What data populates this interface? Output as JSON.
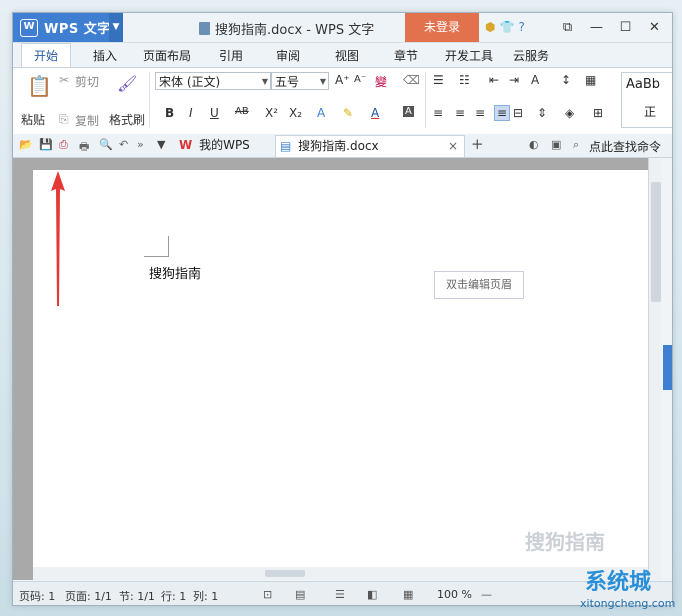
{
  "app": {
    "name": "WPS 文字",
    "logo": "W",
    "doc_title": "搜狗指南.docx - WPS 文字",
    "login": "未登录"
  },
  "menu": {
    "tabs": [
      "开始",
      "插入",
      "页面布局",
      "引用",
      "审阅",
      "视图",
      "章节",
      "开发工具",
      "云服务"
    ]
  },
  "ribbon": {
    "paste": "粘贴",
    "cut": "剪切",
    "copy": "复制",
    "format_painter": "格式刷",
    "font": "宋体 (正文)",
    "size": "五号",
    "style_preview": "AaBb",
    "style_name": "正"
  },
  "quickbar": {
    "tabs": [
      "我的WPS",
      "搜狗指南.docx"
    ],
    "search": "点此查找命令"
  },
  "document": {
    "text": "搜狗指南",
    "header_hint": "双击编辑页眉"
  },
  "status": {
    "page_code": "页码: 1",
    "page": "页面: 1/1",
    "section": "节: 1/1",
    "row": "行: 1",
    "col": "列: 1",
    "zoom": "100 %"
  },
  "watermark": {
    "brand": "搜狗指南",
    "site": "系统城",
    "url": "xitongcheng.com"
  },
  "colors": {
    "accent": "#3f7fd1",
    "login": "#e2714e",
    "arrow": "#e53935"
  }
}
